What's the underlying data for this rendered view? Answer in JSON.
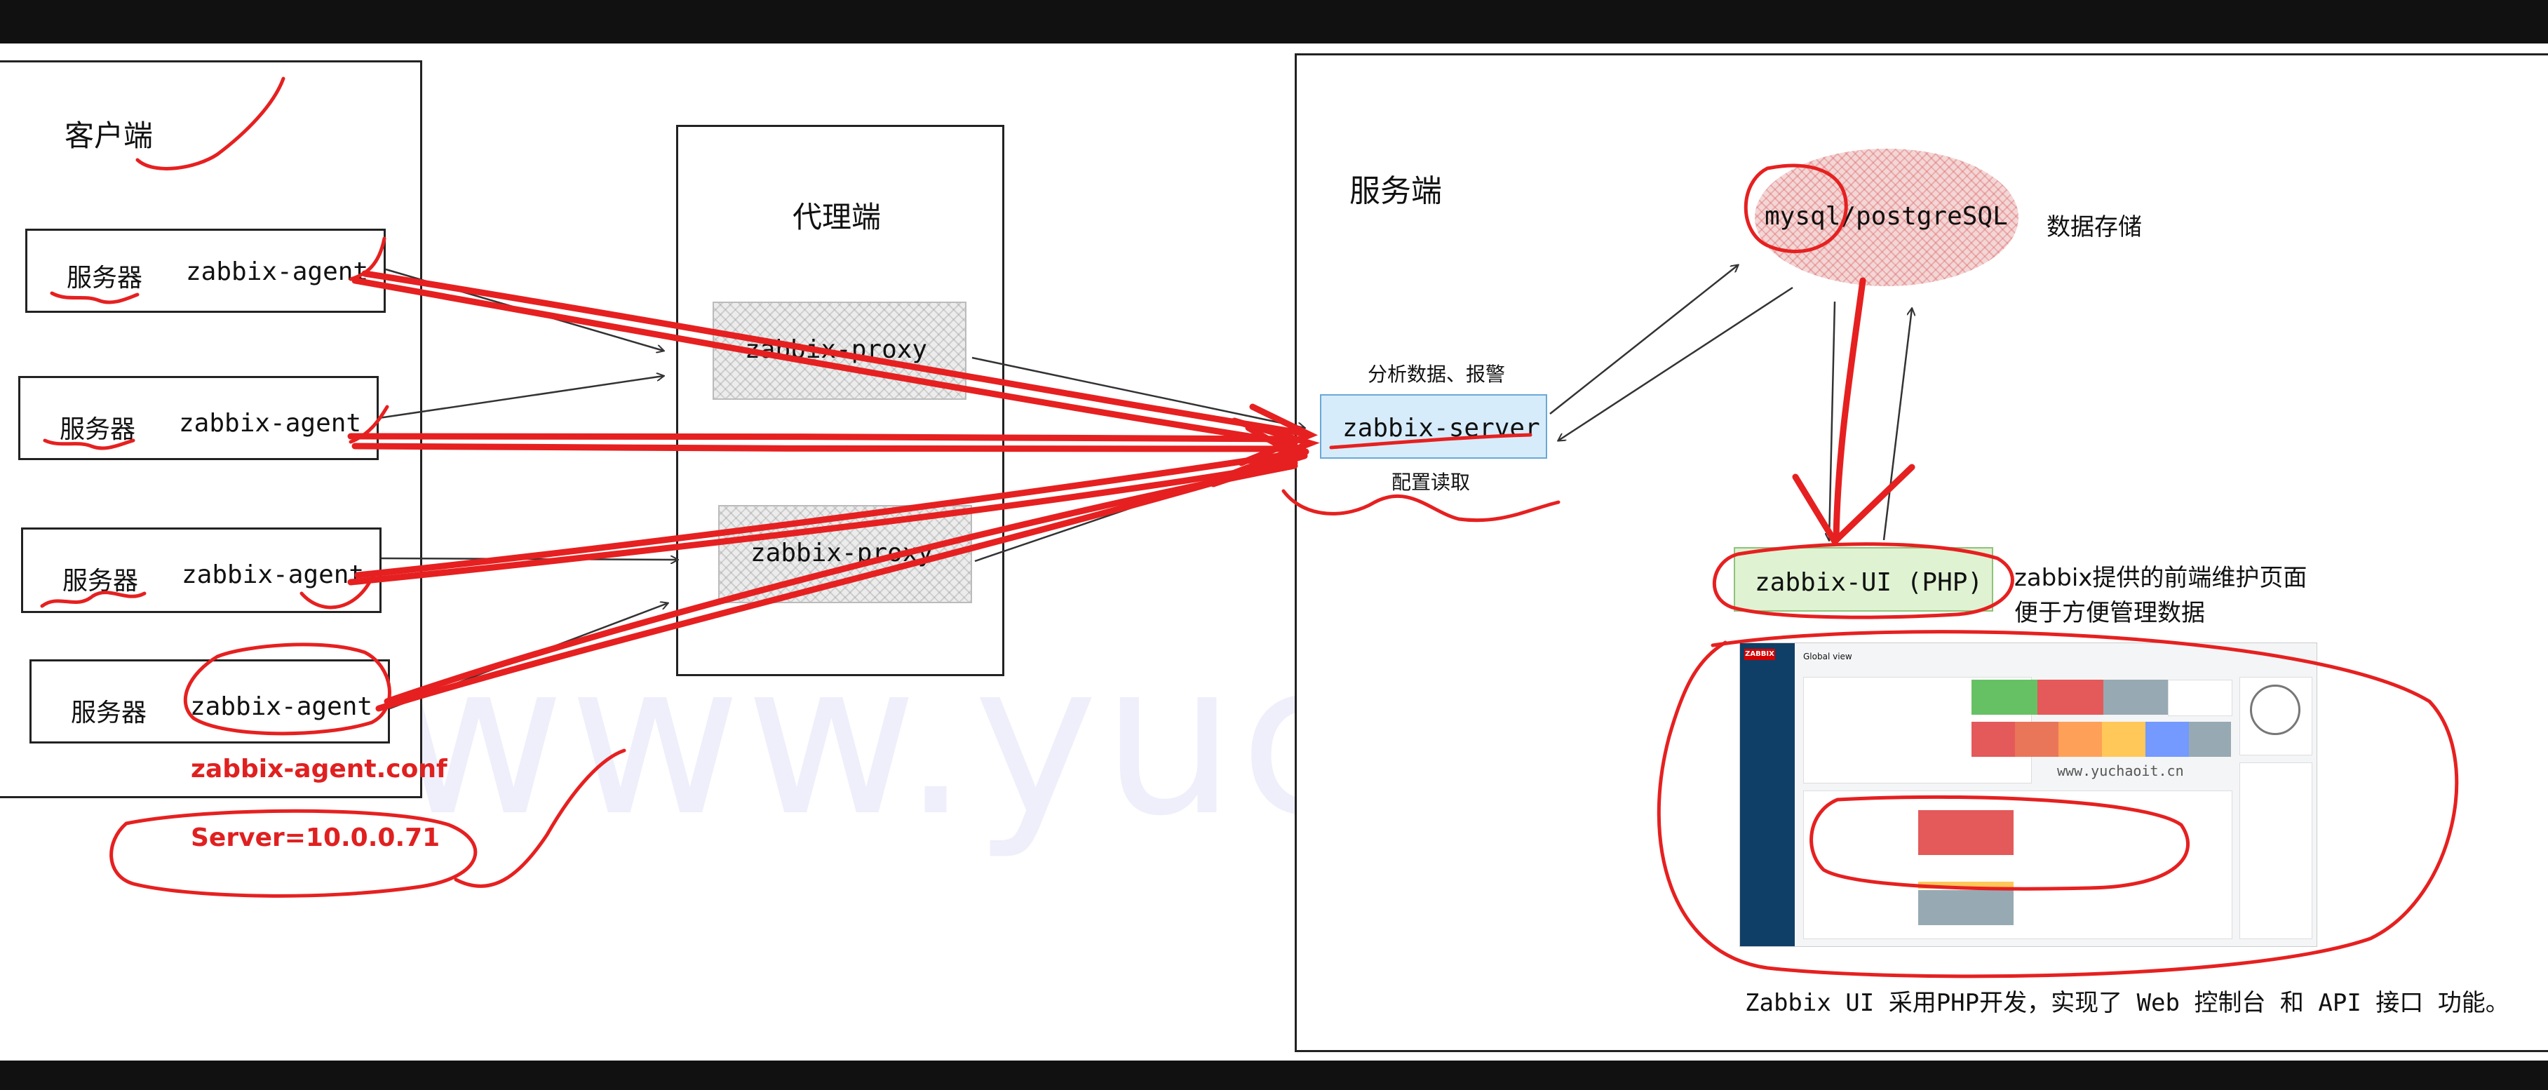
{
  "client": {
    "title": "客户端",
    "rows": [
      {
        "server": "服务器",
        "agent": "zabbix-agent"
      },
      {
        "server": "服务器",
        "agent": "zabbix-agent"
      },
      {
        "server": "服务器",
        "agent": "zabbix-agent"
      },
      {
        "server": "服务器",
        "agent": "zabbix-agent"
      }
    ],
    "conf_file": "zabbix-agent.conf",
    "conf_value": "Server=10.0.0.71"
  },
  "proxy": {
    "title": "代理端",
    "proxies": [
      "zabbix-proxy",
      "zabbix-proxy"
    ]
  },
  "server_side": {
    "title": "服务端",
    "server_label": "zabbix-server",
    "analyze": "分析数据、报警",
    "config": "配置读取",
    "db": "mysql/postgreSQL",
    "db_desc": "数据存储",
    "ui": "zabbix-UI  (PHP)",
    "ui_desc_1": "zabbix提供的前端维护页面",
    "ui_desc_2": "便于方便管理数据",
    "footer": "Zabbix UI 采用PHP开发，实现了 Web 控制台 和 API 接口 功能。"
  },
  "thumbnail": {
    "logo": "ZABBIX",
    "header": "Global view",
    "watermark": "www.yuchaoit.cn"
  },
  "watermark": "www.yuchaoit.cn",
  "colors": {
    "annotation": "#e02020",
    "server_box": "#d6ecfa",
    "ui_box": "#dff2d2",
    "db_fill": "#f3d6d6"
  }
}
